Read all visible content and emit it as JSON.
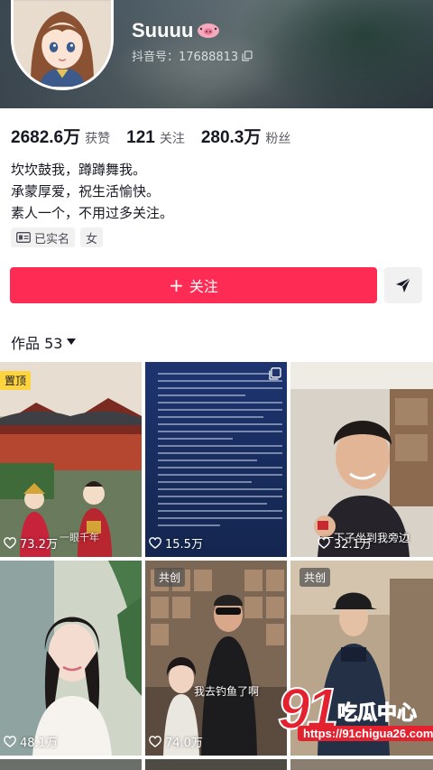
{
  "profile": {
    "nickname": "Suuuu",
    "account_id": "抖音号：17688813",
    "stats": [
      {
        "value": "2682.6万",
        "label": "获赞"
      },
      {
        "value": "121",
        "label": "关注"
      },
      {
        "value": "280.3万",
        "label": "粉丝"
      }
    ],
    "bio": [
      "坎坎鼓我，蹲蹲舞我。",
      "承蒙厚爱，祝生活愉快。",
      "素人一个，不用过多关注。"
    ],
    "tags": [
      {
        "label": "已实名",
        "icon": "id-card-icon"
      },
      {
        "label": "女"
      }
    ],
    "follow_label": "关注",
    "share_icon": "send-icon"
  },
  "works": {
    "label": "作品 53"
  },
  "tiles": [
    {
      "likes": "73.2万",
      "badge": "置顶",
      "caption": "一眼千年"
    },
    {
      "likes": "15.5万",
      "badge": "",
      "caption": ""
    },
    {
      "likes": "32.1万",
      "badge": "",
      "caption": "一下子坐到我旁边"
    },
    {
      "likes": "48.1万",
      "badge": "",
      "caption": ""
    },
    {
      "likes": "74.0万",
      "badge": "共创",
      "caption": "我去钓鱼了啊"
    },
    {
      "likes": "",
      "badge": "共创",
      "caption": ""
    }
  ],
  "watermark": {
    "number": "91",
    "name": "吃瓜中心",
    "url": "https://91chigua26.com"
  },
  "colors": {
    "accent": "#fe2c55",
    "pinned": "#fdd33e",
    "watermark": "#e3212f"
  }
}
